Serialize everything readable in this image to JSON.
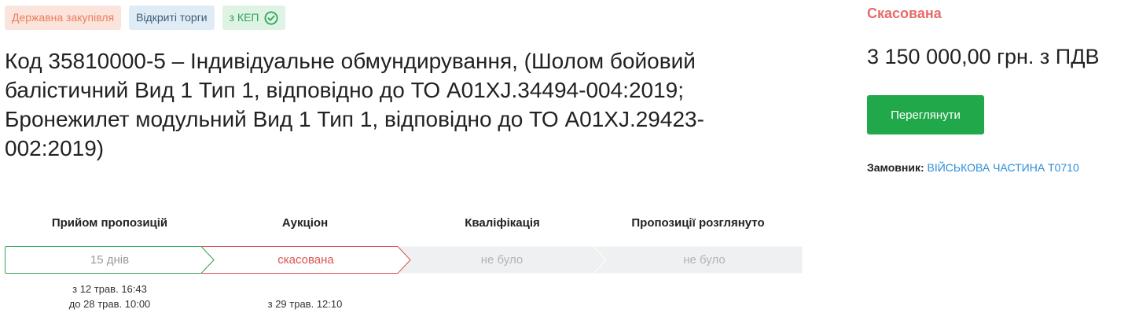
{
  "tags": {
    "procurement_type": "Державна закупівля",
    "procedure": "Відкриті торги",
    "signature": "з КЕП"
  },
  "title": "Код 35810000-5 – Індивідуальне обмундирування, (Шолом бойовий балістичний Вид 1 Тип 1, відповідно до ТО A01XJ.34494-004:2019; Бронежилет модульний Вид 1 Тип 1, відповідно до ТО A01XJ.29423-002:2019)",
  "stages": [
    {
      "label": "Прийом пропозицій",
      "status": "15 днів",
      "date_line1": "з 12 трав. 16:43",
      "date_line2": "до 28 трав. 10:00"
    },
    {
      "label": "Аукціон",
      "status": "скасована",
      "date_line1": "з 29 трав. 12:10",
      "date_line2": ""
    },
    {
      "label": "Кваліфікація",
      "status": "не було",
      "date_line1": "",
      "date_line2": ""
    },
    {
      "label": "Пропозиції розглянуто",
      "status": "не було",
      "date_line1": "",
      "date_line2": ""
    }
  ],
  "sidebar": {
    "status": "Скасована",
    "price": "3 150 000,00 грн. з ПДВ",
    "view_button": "Переглянути",
    "customer_label": "Замовник:",
    "customer_name": "ВІЙСЬКОВА ЧАСТИНА Т0710"
  },
  "colors": {
    "status_cancelled": "#e86b6b",
    "button_green": "#21a84a",
    "link_blue": "#2b8ed8",
    "stage_done": "#3aa85a",
    "stage_cancelled": "#d9534f",
    "stage_inactive": "#eff0f2"
  },
  "icons": {
    "kep_check": "check-circle-icon"
  }
}
